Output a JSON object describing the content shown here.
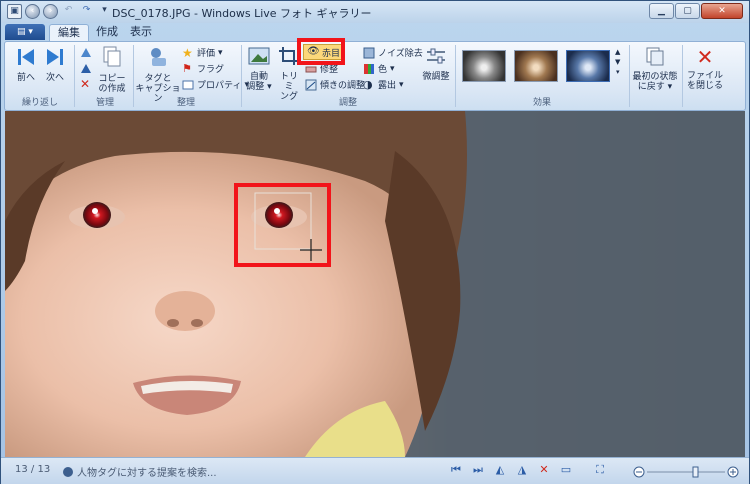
{
  "window": {
    "title": "DSC_0178.JPG - Windows Live フォト ギャラリー",
    "qat_icons": [
      "back-icon",
      "forward-icon",
      "undo-icon",
      "redo-icon",
      "qat-dropdown-icon"
    ],
    "controls": [
      "minimize",
      "maximize",
      "close"
    ]
  },
  "tabs": {
    "app_menu": "▾",
    "items": [
      "編集",
      "作成",
      "表示"
    ],
    "active": "編集"
  },
  "ribbon": {
    "groups": {
      "navigate": {
        "label": "繰り返し",
        "prev": "前へ",
        "next": "次へ"
      },
      "manage": {
        "label": "管理",
        "copy": "コピー\nの作成"
      },
      "organize": {
        "label": "整理",
        "tags": "タグと\nキャプション",
        "rating": "評価",
        "flag": "フラグ",
        "properties": "プロパティ"
      },
      "adjust": {
        "label": "調整",
        "auto": "自動\n調整",
        "trim": "トリミ\nング",
        "redeye": "赤目",
        "retouch": "修整",
        "straighten": "傾きの調整",
        "noise": "ノイズ除去",
        "color": "色",
        "exposure": "露出",
        "fine": "微調整"
      },
      "effects": {
        "label": "効果"
      },
      "revert": {
        "label": "最初の状態\nに戻す"
      },
      "close": {
        "label": "ファイル\nを閉じる"
      }
    }
  },
  "status": {
    "counter": "13 / 13",
    "search_text": "人物タグに対する提案を検索..."
  },
  "colors": {
    "accent": "#2b5ca6",
    "highlight": "#f2141a",
    "redeye": "#c0121c"
  }
}
